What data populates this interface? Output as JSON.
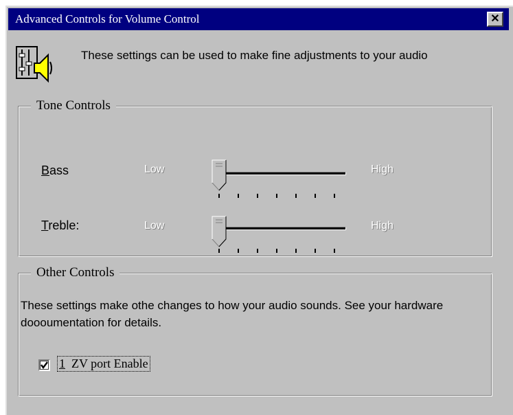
{
  "window": {
    "title": "Advanced Controls for Volume Control",
    "close_label": "✕"
  },
  "header": {
    "icon": "mixer-speaker-icon",
    "description": "These settings can be used to make fine adjustments to your audio"
  },
  "tone_controls": {
    "legend": "Tone Controls",
    "bass": {
      "label_accel": "B",
      "label_rest": "ass",
      "low": "Low",
      "high": "High",
      "level": 0
    },
    "treble": {
      "label_accel": "T",
      "label_rest": "reble:",
      "low": "Low",
      "high": "High",
      "level": 0
    }
  },
  "other_controls": {
    "legend": "Other Controls",
    "description": "These settings make othe changes to how your audio sounds. See your hardware doooumentation for details.",
    "checkbox": {
      "label_accel": "1",
      "label_rest": "  ZV port Enable",
      "checked": true
    }
  }
}
